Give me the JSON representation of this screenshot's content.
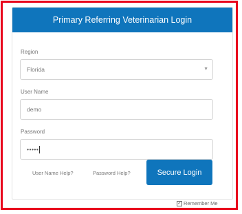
{
  "login": {
    "header_title": "Primary Referring Veterinarian Login",
    "region_label": "Region",
    "region_value": "Florida",
    "username_label": "User Name",
    "username_value": "demo",
    "password_label": "Password",
    "password_value": "•••••",
    "username_help": "User Name Help?",
    "password_help": "Password Help?",
    "submit_label": "Secure Login",
    "remember_label": "Remember Me",
    "remember_checked": true
  },
  "colors": {
    "accent": "#0f75bc",
    "frame_border": "#e8001a"
  }
}
